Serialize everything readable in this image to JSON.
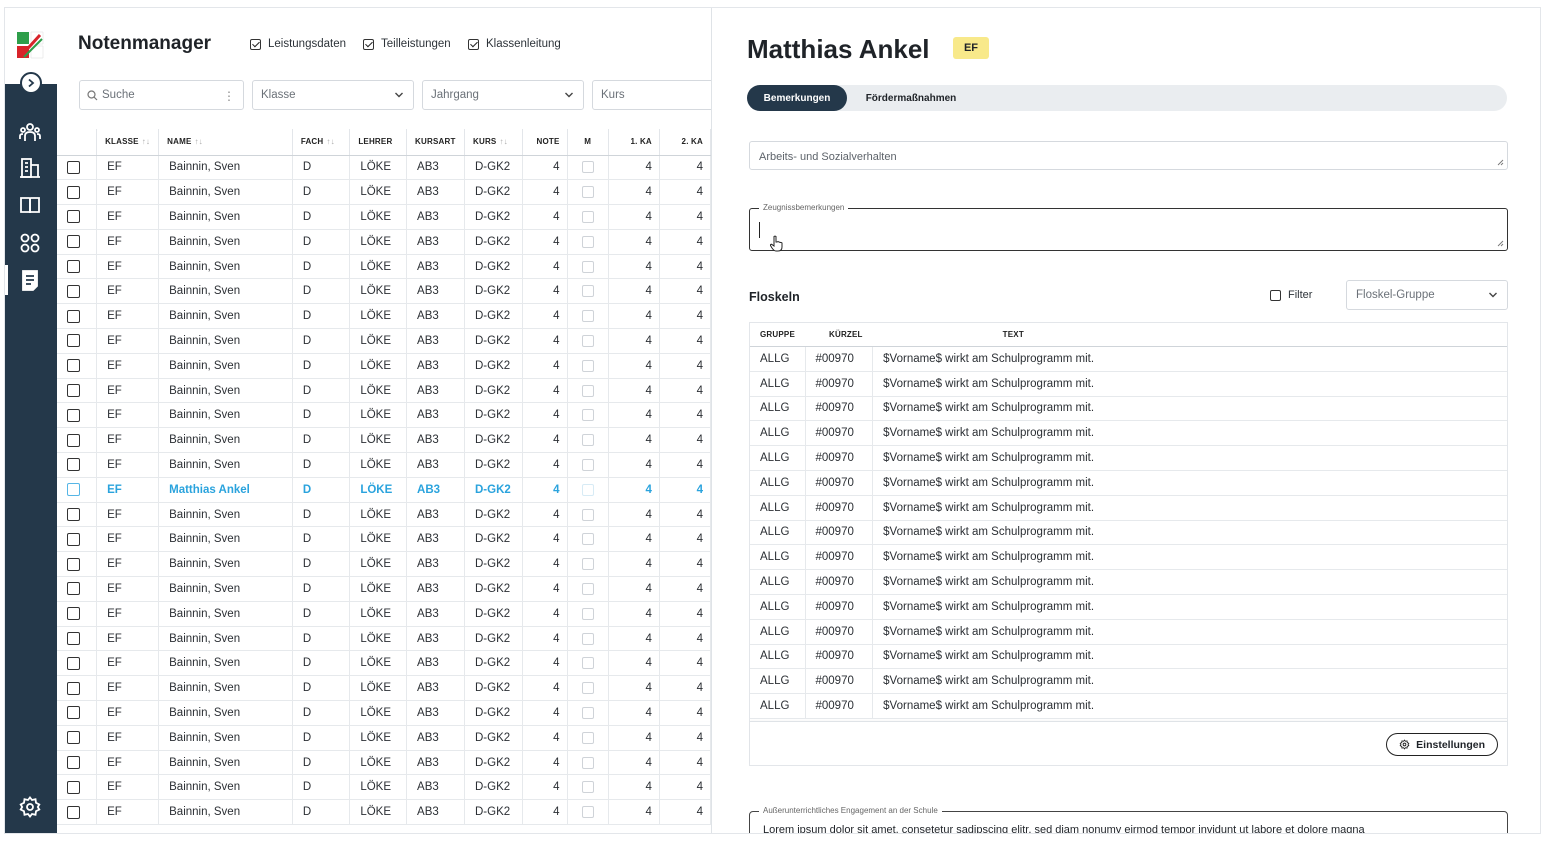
{
  "app": {
    "title": "Notenmanager",
    "header_checks": [
      {
        "label": "Leistungsdaten",
        "checked": true
      },
      {
        "label": "Teilleistungen",
        "checked": true
      },
      {
        "label": "Klassenleitung",
        "checked": true
      }
    ]
  },
  "filters": {
    "search_placeholder": "Suche",
    "klasse": "Klasse",
    "jahrgang": "Jahrgang",
    "kurs": "Kurs"
  },
  "sidebar": {
    "icons": [
      "users-icon",
      "building-icon",
      "book-icon",
      "apps-icon",
      "document-icon"
    ],
    "settings_icon": "gear-icon",
    "colors": {
      "bg": "#24384a"
    }
  },
  "grid": {
    "columns": [
      "KLASSE",
      "NAME",
      "FACH",
      "LEHRER",
      "KURSART",
      "KURS",
      "NOTE",
      "M",
      "1. KA",
      "2. KA"
    ],
    "rows": [
      [
        "EF",
        "Bainnin, Sven",
        "D",
        "LÖKE",
        "AB3",
        "D-GK2",
        "4",
        "4",
        "4"
      ],
      [
        "EF",
        "Bainnin, Sven",
        "D",
        "LÖKE",
        "AB3",
        "D-GK2",
        "4",
        "4",
        "4"
      ],
      [
        "EF",
        "Bainnin, Sven",
        "D",
        "LÖKE",
        "AB3",
        "D-GK2",
        "4",
        "4",
        "4"
      ],
      [
        "EF",
        "Bainnin, Sven",
        "D",
        "LÖKE",
        "AB3",
        "D-GK2",
        "4",
        "4",
        "4"
      ],
      [
        "EF",
        "Bainnin, Sven",
        "D",
        "LÖKE",
        "AB3",
        "D-GK2",
        "4",
        "4",
        "4"
      ],
      [
        "EF",
        "Bainnin, Sven",
        "D",
        "LÖKE",
        "AB3",
        "D-GK2",
        "4",
        "4",
        "4"
      ],
      [
        "EF",
        "Bainnin, Sven",
        "D",
        "LÖKE",
        "AB3",
        "D-GK2",
        "4",
        "4",
        "4"
      ],
      [
        "EF",
        "Bainnin, Sven",
        "D",
        "LÖKE",
        "AB3",
        "D-GK2",
        "4",
        "4",
        "4"
      ],
      [
        "EF",
        "Bainnin, Sven",
        "D",
        "LÖKE",
        "AB3",
        "D-GK2",
        "4",
        "4",
        "4"
      ],
      [
        "EF",
        "Bainnin, Sven",
        "D",
        "LÖKE",
        "AB3",
        "D-GK2",
        "4",
        "4",
        "4"
      ],
      [
        "EF",
        "Bainnin, Sven",
        "D",
        "LÖKE",
        "AB3",
        "D-GK2",
        "4",
        "4",
        "4"
      ],
      [
        "EF",
        "Bainnin, Sven",
        "D",
        "LÖKE",
        "AB3",
        "D-GK2",
        "4",
        "4",
        "4"
      ],
      [
        "EF",
        "Bainnin, Sven",
        "D",
        "LÖKE",
        "AB3",
        "D-GK2",
        "4",
        "4",
        "4"
      ],
      [
        "EF",
        "Matthias Ankel",
        "D",
        "LÖKE",
        "AB3",
        "D-GK2",
        "4",
        "4",
        "4"
      ],
      [
        "EF",
        "Bainnin, Sven",
        "D",
        "LÖKE",
        "AB3",
        "D-GK2",
        "4",
        "4",
        "4"
      ],
      [
        "EF",
        "Bainnin, Sven",
        "D",
        "LÖKE",
        "AB3",
        "D-GK2",
        "4",
        "4",
        "4"
      ],
      [
        "EF",
        "Bainnin, Sven",
        "D",
        "LÖKE",
        "AB3",
        "D-GK2",
        "4",
        "4",
        "4"
      ],
      [
        "EF",
        "Bainnin, Sven",
        "D",
        "LÖKE",
        "AB3",
        "D-GK2",
        "4",
        "4",
        "4"
      ],
      [
        "EF",
        "Bainnin, Sven",
        "D",
        "LÖKE",
        "AB3",
        "D-GK2",
        "4",
        "4",
        "4"
      ],
      [
        "EF",
        "Bainnin, Sven",
        "D",
        "LÖKE",
        "AB3",
        "D-GK2",
        "4",
        "4",
        "4"
      ],
      [
        "EF",
        "Bainnin, Sven",
        "D",
        "LÖKE",
        "AB3",
        "D-GK2",
        "4",
        "4",
        "4"
      ],
      [
        "EF",
        "Bainnin, Sven",
        "D",
        "LÖKE",
        "AB3",
        "D-GK2",
        "4",
        "4",
        "4"
      ],
      [
        "EF",
        "Bainnin, Sven",
        "D",
        "LÖKE",
        "AB3",
        "D-GK2",
        "4",
        "4",
        "4"
      ],
      [
        "EF",
        "Bainnin, Sven",
        "D",
        "LÖKE",
        "AB3",
        "D-GK2",
        "4",
        "4",
        "4"
      ],
      [
        "EF",
        "Bainnin, Sven",
        "D",
        "LÖKE",
        "AB3",
        "D-GK2",
        "4",
        "4",
        "4"
      ],
      [
        "EF",
        "Bainnin, Sven",
        "D",
        "LÖKE",
        "AB3",
        "D-GK2",
        "4",
        "4",
        "4"
      ],
      [
        "EF",
        "Bainnin, Sven",
        "D",
        "LÖKE",
        "AB3",
        "D-GK2",
        "4",
        "4",
        "4"
      ]
    ],
    "selected_row": 13,
    "colors": {
      "selected": "#2aa3dd"
    }
  },
  "detail": {
    "student_name": "Matthias Ankel",
    "badge": "EF",
    "badge_color": "#f8e98a",
    "tabs": [
      {
        "label": "Bemerkungen",
        "active": true
      },
      {
        "label": "Fördermaßnahmen",
        "active": false
      }
    ],
    "asv_placeholder": "Arbeits- und Sozialverhalten",
    "zeugnis_label": "Zeugnissbemerkungen",
    "floskeln_title": "Floskeln",
    "filter_label": "Filter",
    "group_select": "Floskel-Gruppe",
    "floskel_columns": [
      "GRUPPE",
      "KÜRZEL",
      "TEXT"
    ],
    "floskeln": [
      [
        "ALLG",
        "#00970",
        "$Vorname$ wirkt am Schulprogramm mit."
      ],
      [
        "ALLG",
        "#00970",
        "$Vorname$ wirkt am Schulprogramm mit."
      ],
      [
        "ALLG",
        "#00970",
        "$Vorname$ wirkt am Schulprogramm mit."
      ],
      [
        "ALLG",
        "#00970",
        "$Vorname$ wirkt am Schulprogramm mit."
      ],
      [
        "ALLG",
        "#00970",
        "$Vorname$ wirkt am Schulprogramm mit."
      ],
      [
        "ALLG",
        "#00970",
        "$Vorname$ wirkt am Schulprogramm mit."
      ],
      [
        "ALLG",
        "#00970",
        "$Vorname$ wirkt am Schulprogramm mit."
      ],
      [
        "ALLG",
        "#00970",
        "$Vorname$ wirkt am Schulprogramm mit."
      ],
      [
        "ALLG",
        "#00970",
        "$Vorname$ wirkt am Schulprogramm mit."
      ],
      [
        "ALLG",
        "#00970",
        "$Vorname$ wirkt am Schulprogramm mit."
      ],
      [
        "ALLG",
        "#00970",
        "$Vorname$ wirkt am Schulprogramm mit."
      ],
      [
        "ALLG",
        "#00970",
        "$Vorname$ wirkt am Schulprogramm mit."
      ],
      [
        "ALLG",
        "#00970",
        "$Vorname$ wirkt am Schulprogramm mit."
      ],
      [
        "ALLG",
        "#00970",
        "$Vorname$ wirkt am Schulprogramm mit."
      ],
      [
        "ALLG",
        "#00970",
        "$Vorname$ wirkt am Schulprogramm mit."
      ]
    ],
    "settings_button": "Einstellungen",
    "engagement_label": "Außerunterrichtliches Engagement an der Schule",
    "engagement_text": "Lorem ipsum dolor sit amet, consetetur sadipscing elitr, sed diam nonumy eirmod tempor invidunt ut labore et dolore magna"
  }
}
